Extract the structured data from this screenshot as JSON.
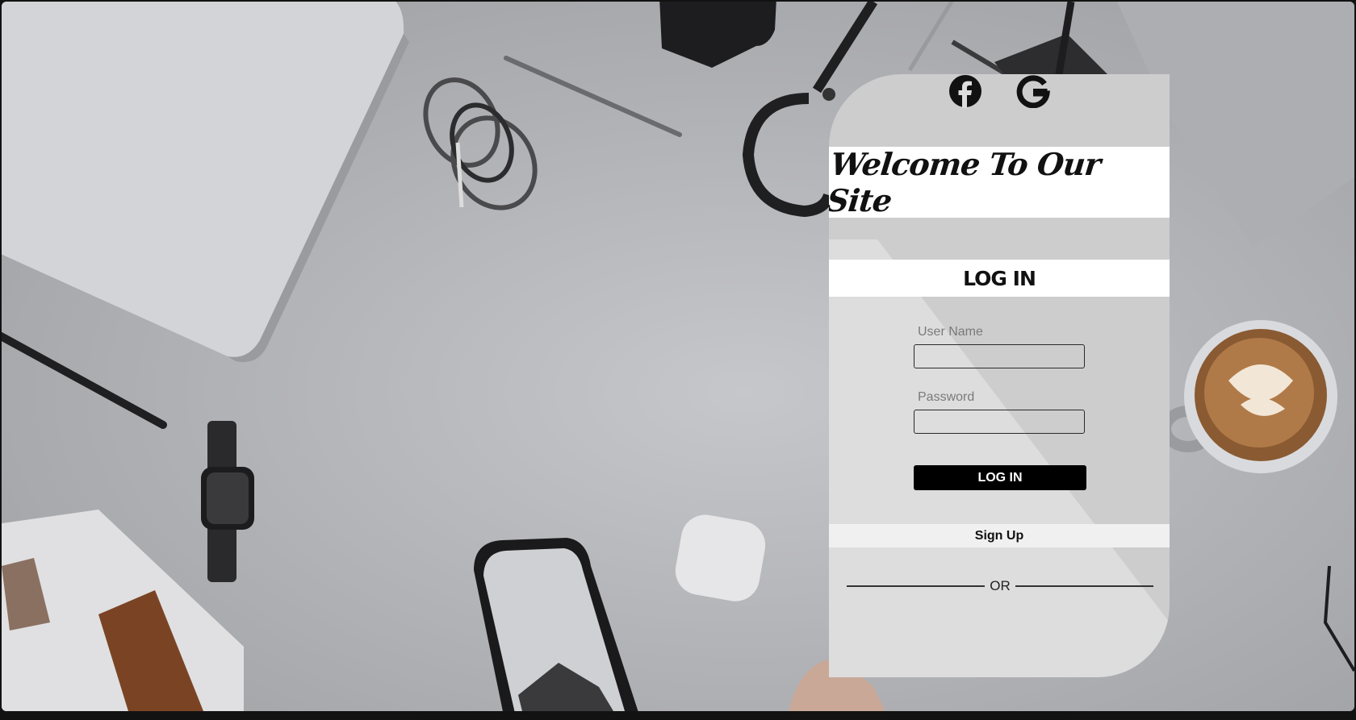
{
  "card": {
    "welcome_title": "Welcome To Our Site",
    "login_heading": "LOG IN",
    "username_label": "User Name",
    "username_value": "",
    "password_label": "Password",
    "password_value": "",
    "login_button": "LOG IN",
    "signup_link": "Sign Up",
    "or_text": "OR"
  },
  "social": {
    "icons": [
      "facebook-icon",
      "google-icon"
    ]
  },
  "colors": {
    "card_background": "#cdcdcd",
    "band_background": "#ffffff",
    "button_background": "#000000",
    "button_text": "#ffffff"
  }
}
